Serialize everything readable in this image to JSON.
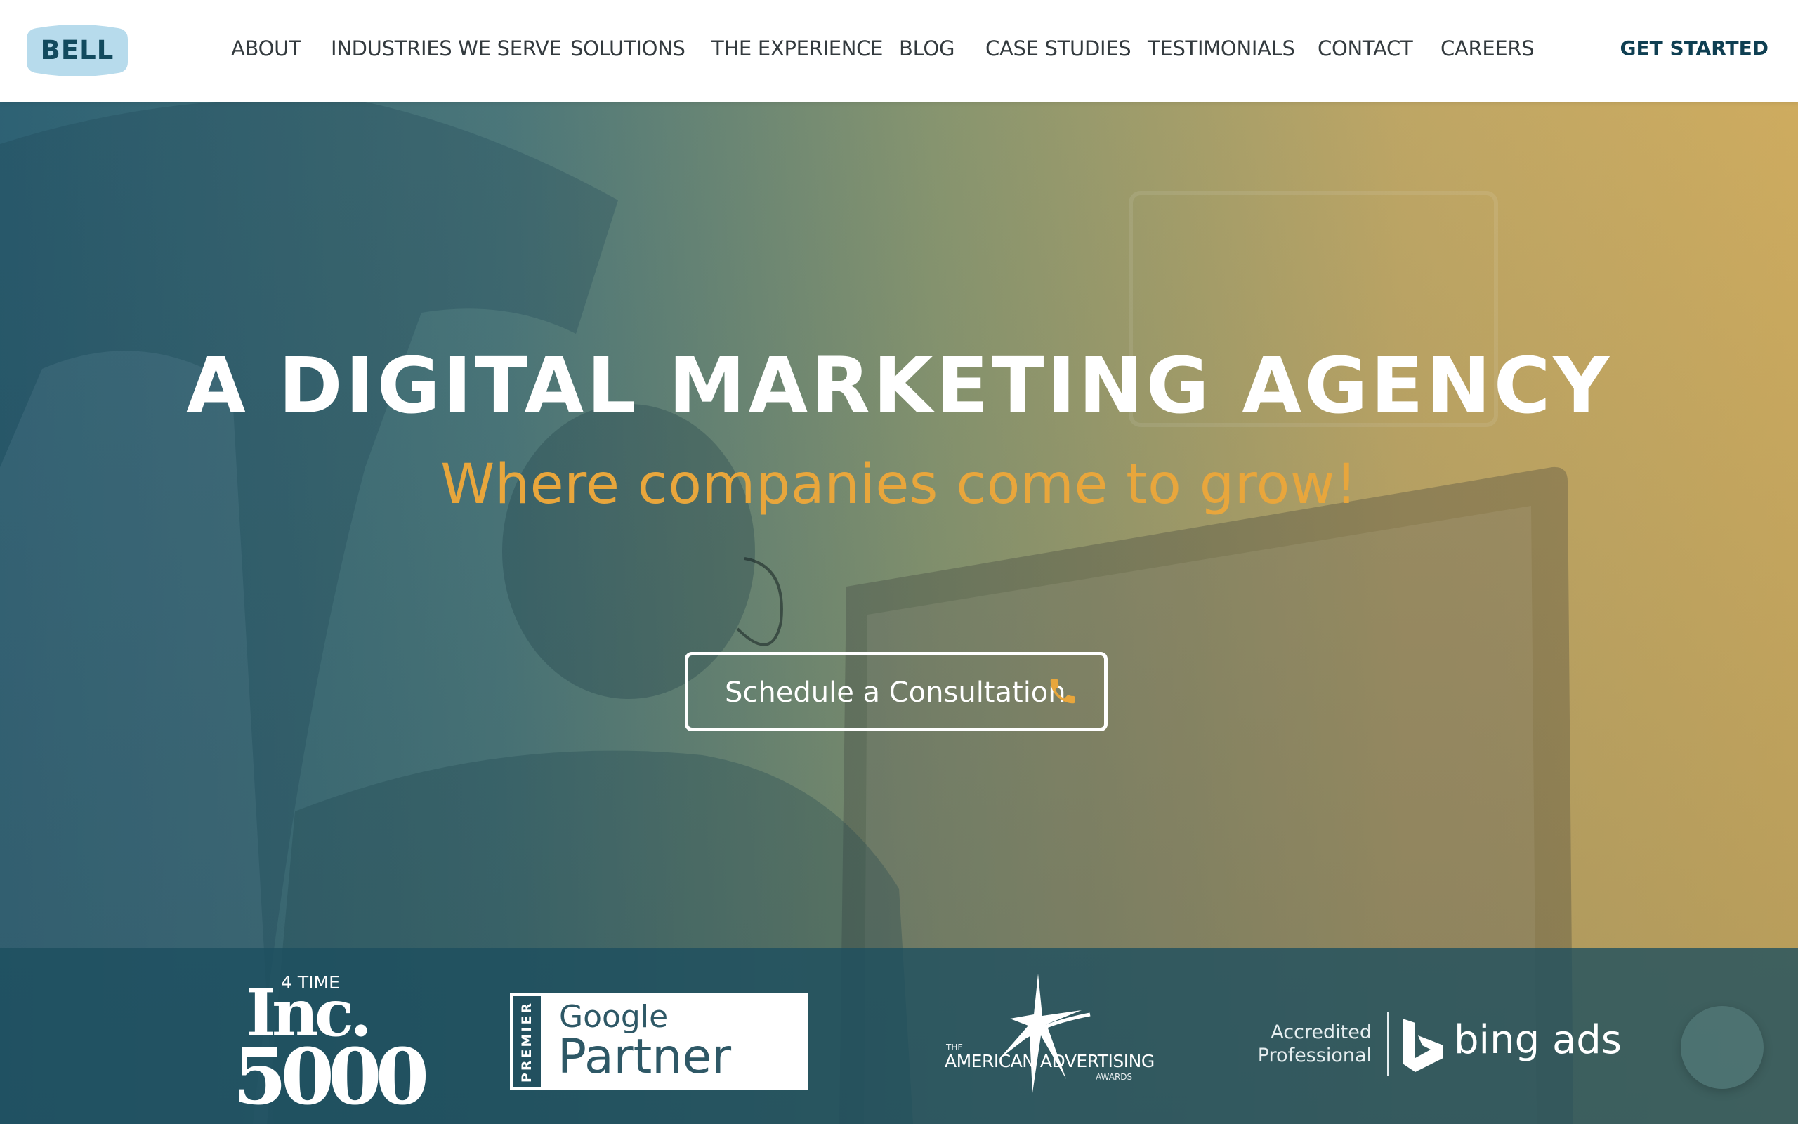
{
  "header": {
    "logo_text": "BELL",
    "nav": [
      {
        "label": "ABOUT"
      },
      {
        "label": "INDUSTRIES WE SERVE"
      },
      {
        "label": "SOLUTIONS"
      },
      {
        "label": "THE EXPERIENCE"
      },
      {
        "label": "BLOG"
      },
      {
        "label": "CASE STUDIES"
      },
      {
        "label": "TESTIMONIALS"
      },
      {
        "label": "CONTACT"
      },
      {
        "label": "CAREERS"
      }
    ],
    "cta_label": "GET STARTED"
  },
  "hero": {
    "title": "A DIGITAL MARKETING AGENCY",
    "subtitle": "Where companies come to grow!",
    "button_label": "Schedule a Consultation",
    "button_icon": "phone-icon"
  },
  "awards": {
    "inc": {
      "top": "4 TIME",
      "word": "Inc.",
      "number": "5000"
    },
    "google": {
      "strip": "PREMIER",
      "brand": "Google",
      "label": "Partner"
    },
    "aaa": {
      "the": "THE",
      "name": "AMERICAN ADVERTISING",
      "sub": "AWARDS"
    },
    "bing": {
      "line1": "Accredited",
      "line2": "Professional",
      "brand": "bing ads"
    }
  },
  "colors": {
    "brand_dark": "#124a5e",
    "logo_bg": "#b7dbec",
    "accent_orange": "#e8a63c",
    "awards_bar": "#1c4e5f"
  },
  "icons": [
    "phone-icon",
    "bing-logo-icon",
    "american-advertising-star-icon",
    "chat-icon"
  ]
}
